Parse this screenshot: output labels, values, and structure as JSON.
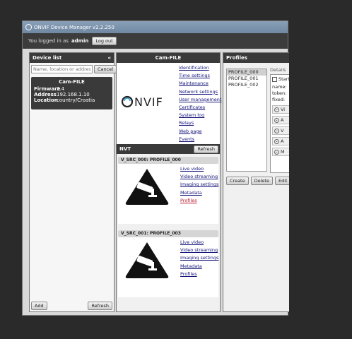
{
  "window": {
    "title": "ONVIF Device Manager v2.2.250"
  },
  "topbar": {
    "logged_text": "You logged in as",
    "user": "admin",
    "logout_label": "Log out"
  },
  "device_list": {
    "header": "Device list",
    "collapse_icon": "«",
    "search_placeholder": "Name, location or address",
    "cancel_label": "Cancel",
    "devices": [
      {
        "name": "Cam-FILE",
        "firmware_label": "Firmware",
        "firmware": "2.4",
        "address_label": "Address",
        "address": "192.168.1.10",
        "location_label": "Location",
        "location": "country/Croatia"
      }
    ],
    "add_label": "Add",
    "refresh_label": "Refresh"
  },
  "cam": {
    "header": "Cam-FILE",
    "logo_text": "Onvif",
    "links": [
      "Identification",
      "Time settings",
      "Maintenance",
      "Network settings",
      "User management",
      "Certificates",
      "System log",
      "Relays",
      "Web page",
      "Events"
    ],
    "nvt_label": "NVT",
    "nvt_refresh": "Refresh",
    "profiles": [
      {
        "title": "V_SRC_000: PROFILE_000",
        "links": [
          "Live video",
          "Video streaming",
          "Imaging settings",
          "Metadata",
          "Profiles"
        ],
        "active_index": 4
      },
      {
        "title": "V_SRC_001: PROFILE_003",
        "links": [
          "Live video",
          "Video streaming",
          "Imaging settings",
          "Metadata",
          "Profiles"
        ],
        "active_index": -1
      }
    ]
  },
  "profiles_panel": {
    "header": "Profiles",
    "items": [
      "PROFILE_000",
      "PROFILE_001",
      "PROFILE_002"
    ],
    "selected": 0,
    "details_label": "Details",
    "start_label": "Start",
    "fields": [
      "name:",
      "token:",
      "fixed:"
    ],
    "sections": [
      "Vi",
      "A",
      "V",
      "A",
      "M"
    ],
    "buttons": [
      "Create",
      "Delete",
      "Edit",
      "S"
    ]
  }
}
